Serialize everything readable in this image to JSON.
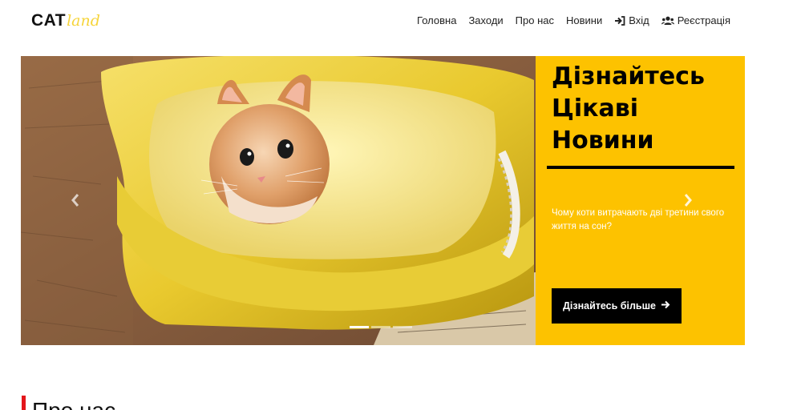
{
  "logo": {
    "main": "CAT",
    "script": "land"
  },
  "nav": [
    {
      "label": "Головна",
      "icon": ""
    },
    {
      "label": "Заходи",
      "icon": ""
    },
    {
      "label": "Про нас",
      "icon": ""
    },
    {
      "label": "Новини",
      "icon": ""
    },
    {
      "label": "Вхід",
      "icon": "sign-in-icon"
    },
    {
      "label": "Реєстрація",
      "icon": "users-icon"
    }
  ],
  "hero": {
    "title_line1": "Дізнайтесь",
    "title_line2": "Цікаві",
    "title_line3": "Новини",
    "text": "Чому коти витрачають дві третини свого життя на сон?",
    "button_label": "Дізнайтесь більше",
    "button_icon": "arrow-right-icon",
    "active_slide": 1,
    "slide_count": 3,
    "panel_color": "#fdc200"
  },
  "section": {
    "title": "Про нас",
    "accent_color": "#e3161b"
  }
}
